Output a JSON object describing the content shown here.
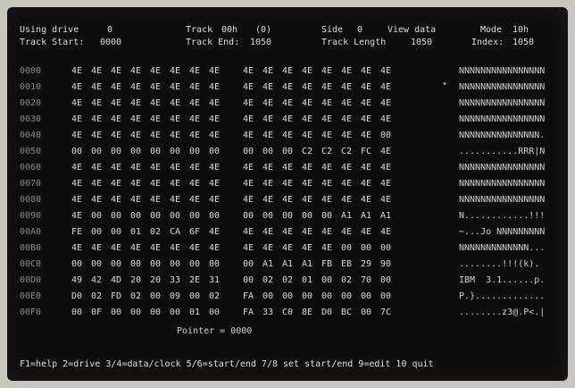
{
  "header": {
    "drive_label": "Using drive",
    "drive_value": "0",
    "track_label": "Track",
    "track_value": "00h",
    "track_dec": "(0)",
    "side_label": "Side",
    "side_value": "0",
    "view_label": "View data",
    "mode_label": "Mode",
    "mode_value": "10h",
    "track_start_label": "Track Start:",
    "track_start_value": "0000",
    "track_end_label": "Track End:",
    "track_end_value": "1050",
    "track_length_label": "Track Length",
    "track_length_value": "1050",
    "index_label": "Index:",
    "index_value": "1050"
  },
  "rows": [
    {
      "offset": "0000",
      "bytes": [
        "4E",
        "4E",
        "4E",
        "4E",
        "4E",
        "4E",
        "4E",
        "4E",
        "4E",
        "4E",
        "4E",
        "4E",
        "4E",
        "4E",
        "4E",
        "4E"
      ],
      "ascii": "NNNNNNNNNNNNNNNN"
    },
    {
      "offset": "0010",
      "bytes": [
        "4E",
        "4E",
        "4E",
        "4E",
        "4E",
        "4E",
        "4E",
        "4E",
        "4E",
        "4E",
        "4E",
        "4E",
        "4E",
        "4E",
        "4E",
        "4E"
      ],
      "ascii": "NNNNNNNNNNNNNNNN"
    },
    {
      "offset": "0020",
      "bytes": [
        "4E",
        "4E",
        "4E",
        "4E",
        "4E",
        "4E",
        "4E",
        "4E",
        "4E",
        "4E",
        "4E",
        "4E",
        "4E",
        "4E",
        "4E",
        "4E"
      ],
      "ascii": "NNNNNNNNNNNNNNNN"
    },
    {
      "offset": "0030",
      "bytes": [
        "4E",
        "4E",
        "4E",
        "4E",
        "4E",
        "4E",
        "4E",
        "4E",
        "4E",
        "4E",
        "4E",
        "4E",
        "4E",
        "4E",
        "4E",
        "4E"
      ],
      "ascii": "NNNNNNNNNNNNNNNN"
    },
    {
      "offset": "0040",
      "bytes": [
        "4E",
        "4E",
        "4E",
        "4E",
        "4E",
        "4E",
        "4E",
        "4E",
        "4E",
        "4E",
        "4E",
        "4E",
        "4E",
        "4E",
        "4E",
        "00"
      ],
      "ascii": "NNNNNNNNNNNNNNN."
    },
    {
      "offset": "0050",
      "bytes": [
        "00",
        "00",
        "00",
        "00",
        "00",
        "00",
        "00",
        "00",
        "00",
        "00",
        "00",
        "C2",
        "C2",
        "C2",
        "FC",
        "4E"
      ],
      "ascii": "...........RRR|N"
    },
    {
      "offset": "0060",
      "bytes": [
        "4E",
        "4E",
        "4E",
        "4E",
        "4E",
        "4E",
        "4E",
        "4E",
        "4E",
        "4E",
        "4E",
        "4E",
        "4E",
        "4E",
        "4E",
        "4E"
      ],
      "ascii": "NNNNNNNNNNNNNNNN"
    },
    {
      "offset": "0070",
      "bytes": [
        "4E",
        "4E",
        "4E",
        "4E",
        "4E",
        "4E",
        "4E",
        "4E",
        "4E",
        "4E",
        "4E",
        "4E",
        "4E",
        "4E",
        "4E",
        "4E"
      ],
      "ascii": "NNNNNNNNNNNNNNNN"
    },
    {
      "offset": "0080",
      "bytes": [
        "4E",
        "4E",
        "4E",
        "4E",
        "4E",
        "4E",
        "4E",
        "4E",
        "4E",
        "4E",
        "4E",
        "4E",
        "4E",
        "4E",
        "4E",
        "4E"
      ],
      "ascii": "NNNNNNNNNNNNNNNN"
    },
    {
      "offset": "0090",
      "bytes": [
        "4E",
        "00",
        "00",
        "00",
        "00",
        "00",
        "00",
        "00",
        "00",
        "00",
        "00",
        "00",
        "00",
        "A1",
        "A1",
        "A1"
      ],
      "ascii": "N............!!!"
    },
    {
      "offset": "00A0",
      "bytes": [
        "FE",
        "00",
        "00",
        "01",
        "02",
        "CA",
        "6F",
        "4E",
        "4E",
        "4E",
        "4E",
        "4E",
        "4E",
        "4E",
        "4E",
        "4E"
      ],
      "ascii": "~...Jo NNNNNNNNN"
    },
    {
      "offset": "00B0",
      "bytes": [
        "4E",
        "4E",
        "4E",
        "4E",
        "4E",
        "4E",
        "4E",
        "4E",
        "4E",
        "4E",
        "4E",
        "4E",
        "4E",
        "00",
        "00",
        "00"
      ],
      "ascii": "NNNNNNNNNNNNN..."
    },
    {
      "offset": "00C0",
      "bytes": [
        "00",
        "00",
        "00",
        "00",
        "00",
        "00",
        "00",
        "00",
        "00",
        "A1",
        "A1",
        "A1",
        "FB",
        "EB",
        "29",
        "90"
      ],
      "ascii": "........!!!(k)."
    },
    {
      "offset": "00D0",
      "bytes": [
        "49",
        "42",
        "4D",
        "20",
        "20",
        "33",
        "2E",
        "31",
        "00",
        "02",
        "02",
        "01",
        "00",
        "02",
        "70",
        "00"
      ],
      "ascii": "IBM  3.1......p."
    },
    {
      "offset": "00E0",
      "bytes": [
        "D0",
        "02",
        "FD",
        "02",
        "00",
        "09",
        "00",
        "02",
        "FA",
        "00",
        "00",
        "00",
        "00",
        "00",
        "00",
        "00"
      ],
      "ascii": "P.}............."
    },
    {
      "offset": "00F0",
      "bytes": [
        "00",
        "0F",
        "00",
        "00",
        "00",
        "00",
        "01",
        "00",
        "FA",
        "33",
        "C0",
        "8E",
        "D0",
        "BC",
        "00",
        "7C"
      ],
      "ascii": "........z3@.P<.|"
    }
  ],
  "pointer_label": "Pointer =",
  "pointer_value": "0000",
  "footer": "F1=help 2=drive 3/4=data/clock 5/6=start/end 7/8 set start/end 9=edit 10 quit"
}
